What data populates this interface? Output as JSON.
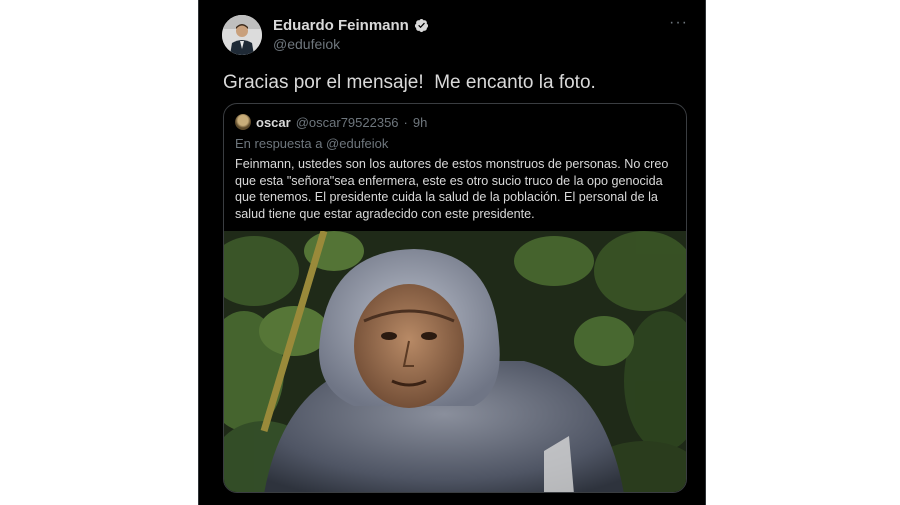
{
  "author": {
    "display_name": "Eduardo Feinmann",
    "handle": "@edufeiok",
    "verified_icon": "verified-badge-icon"
  },
  "tweet": {
    "text": "Gracias por el mensaje!  Me encanto la foto."
  },
  "more_label": "···",
  "quoted_tweet": {
    "name": "oscar",
    "handle": "@oscar79522356",
    "separator": "·",
    "time": "9h",
    "reply_to": "En respuesta a @edufeiok",
    "text": "Feinmann, ustedes son los autores de estos monstruos de personas. No creo que esta \"señora\"sea enfermera, este es otro sucio truco de la opo genocida que tenemos. El presidente cuida la salud de la población. El personal de la salud tiene que estar agradecido con este presidente."
  },
  "colors": {
    "background": "#000000",
    "text": "#d9d9d9",
    "muted": "#6e767d",
    "verified": "#d9d9d9"
  }
}
